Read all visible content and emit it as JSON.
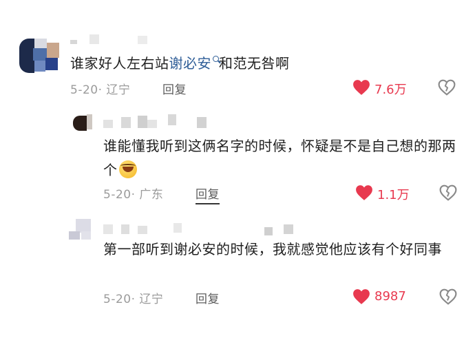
{
  "comments": [
    {
      "text_before": "谁家好人左右站",
      "link": "谢必安",
      "text_after": "和范无咎啊",
      "date": "5-20",
      "location": "辽宁",
      "reply_label": "回复",
      "likes": "7.6万"
    },
    {
      "text": "谁能懂我听到这俩名字的时候，怀疑是不是自己想的那两个",
      "date": "5-20",
      "location": "广东",
      "reply_label": "回复",
      "likes": "1.1万"
    },
    {
      "text": "第一部听到谢必安的时候，我就感觉他应该有个好同事",
      "date": "5-20",
      "location": "辽宁",
      "reply_label": "回复",
      "likes": "8987"
    }
  ],
  "icons": [
    "search-icon",
    "heart-icon",
    "dislike-heart-icon",
    "laughing-emoji-icon"
  ],
  "colors": {
    "like": "#e8394f",
    "link": "#2e5d97",
    "meta": "#9b9b9b"
  }
}
